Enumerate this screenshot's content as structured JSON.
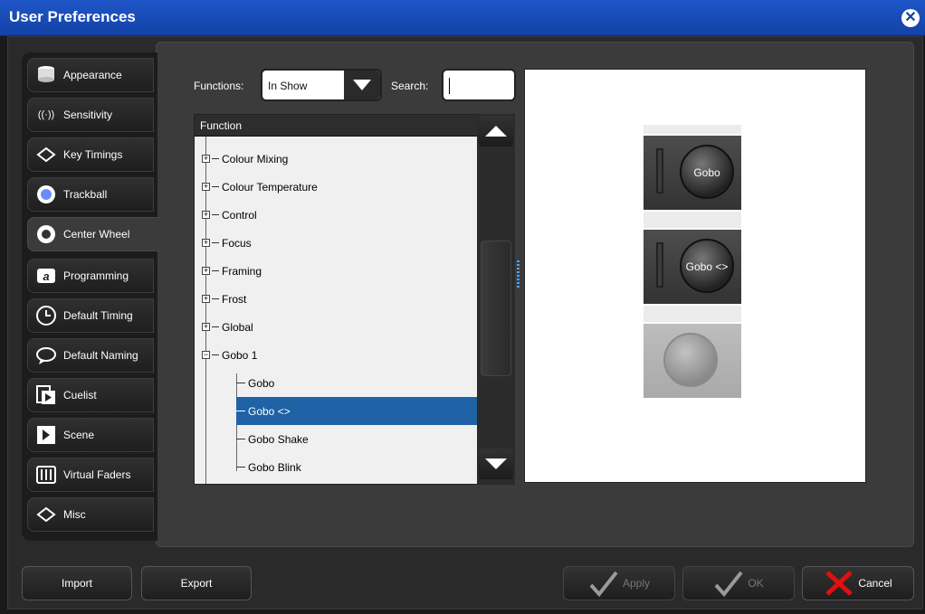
{
  "window": {
    "title": "User Preferences"
  },
  "sidebar": {
    "items": [
      {
        "label": "Appearance",
        "icon": "stack-icon"
      },
      {
        "label": "Sensitivity",
        "icon": "wave-icon"
      },
      {
        "label": "Key Timings",
        "icon": "key-icon"
      },
      {
        "label": "Trackball",
        "icon": "trackball-icon"
      },
      {
        "label": "Center Wheel",
        "icon": "wheel-icon"
      },
      {
        "label": "Programming",
        "icon": "programming-icon"
      },
      {
        "label": "Default Timing",
        "icon": "clock-icon"
      },
      {
        "label": "Default Naming",
        "icon": "speech-bubble-icon"
      },
      {
        "label": "Cuelist",
        "icon": "cuelist-icon"
      },
      {
        "label": "Scene",
        "icon": "scene-icon"
      },
      {
        "label": "Virtual Faders",
        "icon": "faders-icon"
      },
      {
        "label": "Misc",
        "icon": "misc-icon"
      }
    ],
    "active_index": 4
  },
  "filters": {
    "functions_label": "Functions:",
    "functions_value": "In Show",
    "search_label": "Search:",
    "search_value": ""
  },
  "tree": {
    "header": "Function",
    "nodes": [
      {
        "label": "Colour Mixing",
        "state": "+"
      },
      {
        "label": "Colour Temperature",
        "state": "+"
      },
      {
        "label": "Control",
        "state": "+"
      },
      {
        "label": "Focus",
        "state": "+"
      },
      {
        "label": "Framing",
        "state": "+"
      },
      {
        "label": "Frost",
        "state": "+"
      },
      {
        "label": "Global",
        "state": "+"
      },
      {
        "label": "Gobo 1",
        "state": "-"
      },
      {
        "label": "Gobo",
        "state": "child"
      },
      {
        "label": "Gobo <>",
        "state": "child-selected"
      },
      {
        "label": "Gobo Shake",
        "state": "child"
      },
      {
        "label": "Gobo Blink",
        "state": "child"
      }
    ]
  },
  "preview": {
    "tiles": [
      {
        "label": "Gobo"
      },
      {
        "label": "Gobo <>"
      },
      {
        "label": ""
      }
    ]
  },
  "buttons": {
    "import": "Import",
    "export": "Export",
    "apply": "Apply",
    "ok": "OK",
    "cancel": "Cancel"
  },
  "colors": {
    "title_bar": "#1342a6",
    "selection": "#1f62a6",
    "cancel_x": "#e01010"
  }
}
